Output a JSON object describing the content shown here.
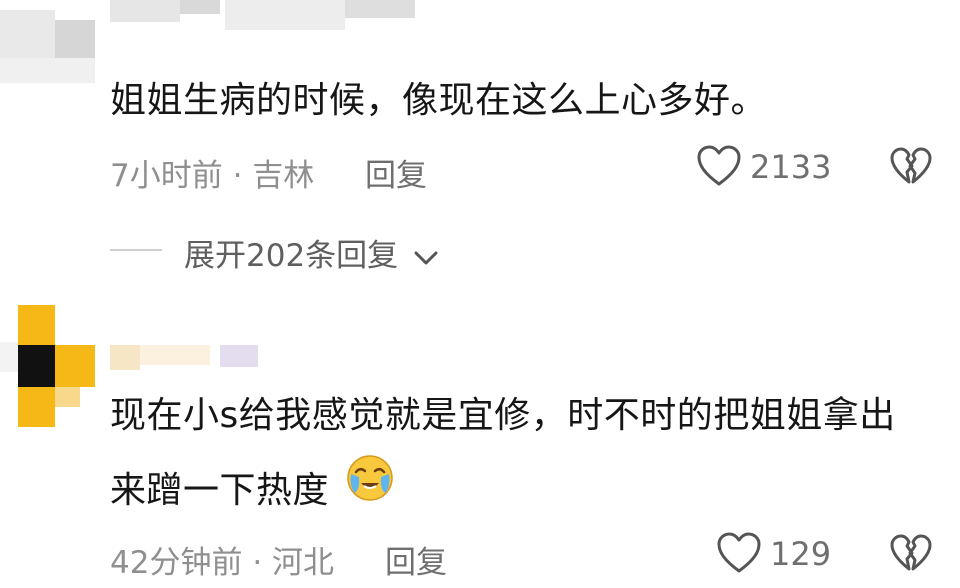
{
  "comments": [
    {
      "text_lines": [
        "姐姐生病的时候，像现在这么上心多好。"
      ],
      "time": "7小时前",
      "separator": "·",
      "location": "吉林",
      "reply_label": "回复",
      "likes": "2133",
      "expand_label": "展开202条回复"
    },
    {
      "text_lines": [
        "现在小s给我感觉就是宜修，时不时的把姐姐拿出",
        "来蹭一下热度"
      ],
      "emoji": "crying-laughing-emoji",
      "time": "42分钟前",
      "separator": "·",
      "location": "河北",
      "reply_label": "回复",
      "likes": "129"
    }
  ],
  "colors": {
    "text": "#161616",
    "meta": "#8f8f8f",
    "icon": "#555555",
    "avatar_yellow": "#f6b817",
    "avatar_dark": "#111111"
  },
  "icons": [
    "heart-outline-icon",
    "broken-heart-icon",
    "chevron-down-icon"
  ]
}
